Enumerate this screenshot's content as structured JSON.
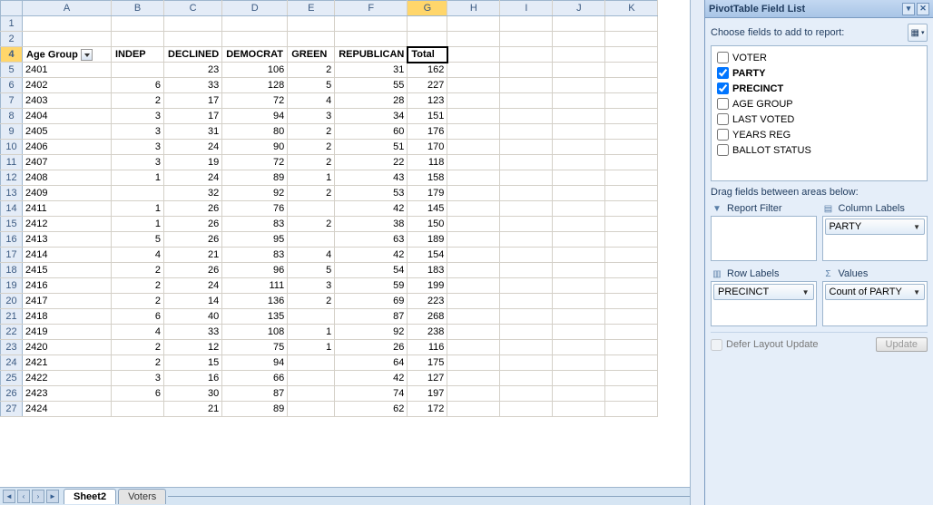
{
  "active_cell": {
    "row_idx": 4,
    "col_idx": 6
  },
  "columns": [
    "A",
    "B",
    "C",
    "D",
    "E",
    "F",
    "G",
    "H",
    "I",
    "J",
    "K"
  ],
  "active_col": "G",
  "header_row_num": 4,
  "headers": [
    "Age Group",
    "INDEP",
    "DECLINED",
    "DEMOCRAT",
    "GREEN",
    "REPUBLICAN",
    "Total"
  ],
  "rows": [
    {
      "n": 5,
      "c": [
        "2401",
        "",
        "23",
        "106",
        "2",
        "31",
        "162"
      ]
    },
    {
      "n": 6,
      "c": [
        "2402",
        "6",
        "33",
        "128",
        "5",
        "55",
        "227"
      ]
    },
    {
      "n": 7,
      "c": [
        "2403",
        "2",
        "17",
        "72",
        "4",
        "28",
        "123"
      ]
    },
    {
      "n": 8,
      "c": [
        "2404",
        "3",
        "17",
        "94",
        "3",
        "34",
        "151"
      ]
    },
    {
      "n": 9,
      "c": [
        "2405",
        "3",
        "31",
        "80",
        "2",
        "60",
        "176"
      ]
    },
    {
      "n": 10,
      "c": [
        "2406",
        "3",
        "24",
        "90",
        "2",
        "51",
        "170"
      ]
    },
    {
      "n": 11,
      "c": [
        "2407",
        "3",
        "19",
        "72",
        "2",
        "22",
        "118"
      ]
    },
    {
      "n": 12,
      "c": [
        "2408",
        "1",
        "24",
        "89",
        "1",
        "43",
        "158"
      ]
    },
    {
      "n": 13,
      "c": [
        "2409",
        "",
        "32",
        "92",
        "2",
        "53",
        "179"
      ]
    },
    {
      "n": 14,
      "c": [
        "2411",
        "1",
        "26",
        "76",
        "",
        "42",
        "145"
      ]
    },
    {
      "n": 15,
      "c": [
        "2412",
        "1",
        "26",
        "83",
        "2",
        "38",
        "150"
      ]
    },
    {
      "n": 16,
      "c": [
        "2413",
        "5",
        "26",
        "95",
        "",
        "63",
        "189"
      ]
    },
    {
      "n": 17,
      "c": [
        "2414",
        "4",
        "21",
        "83",
        "4",
        "42",
        "154"
      ]
    },
    {
      "n": 18,
      "c": [
        "2415",
        "2",
        "26",
        "96",
        "5",
        "54",
        "183"
      ]
    },
    {
      "n": 19,
      "c": [
        "2416",
        "2",
        "24",
        "111",
        "3",
        "59",
        "199"
      ]
    },
    {
      "n": 20,
      "c": [
        "2417",
        "2",
        "14",
        "136",
        "2",
        "69",
        "223"
      ]
    },
    {
      "n": 21,
      "c": [
        "2418",
        "6",
        "40",
        "135",
        "",
        "87",
        "268"
      ]
    },
    {
      "n": 22,
      "c": [
        "2419",
        "4",
        "33",
        "108",
        "1",
        "92",
        "238"
      ]
    },
    {
      "n": 23,
      "c": [
        "2420",
        "2",
        "12",
        "75",
        "1",
        "26",
        "116"
      ]
    },
    {
      "n": 24,
      "c": [
        "2421",
        "2",
        "15",
        "94",
        "",
        "64",
        "175"
      ]
    },
    {
      "n": 25,
      "c": [
        "2422",
        "3",
        "16",
        "66",
        "",
        "42",
        "127"
      ]
    },
    {
      "n": 26,
      "c": [
        "2423",
        "6",
        "30",
        "87",
        "",
        "74",
        "197"
      ]
    },
    {
      "n": 27,
      "c": [
        "2424",
        "",
        "21",
        "89",
        "",
        "62",
        "172"
      ]
    }
  ],
  "blank_lead_rows": [
    1,
    2
  ],
  "tabs": {
    "items": [
      "Sheet2",
      "Voters"
    ],
    "active": "Sheet2"
  },
  "pane": {
    "title": "PivotTable Field List",
    "choose": "Choose fields to add to report:",
    "fields": [
      {
        "label": "VOTER",
        "checked": false
      },
      {
        "label": "PARTY",
        "checked": true
      },
      {
        "label": "PRECINCT",
        "checked": true
      },
      {
        "label": "AGE  GROUP",
        "checked": false
      },
      {
        "label": "LAST  VOTED",
        "checked": false
      },
      {
        "label": "YEARS  REG",
        "checked": false
      },
      {
        "label": "BALLOT  STATUS",
        "checked": false
      }
    ],
    "drag": "Drag fields between areas below:",
    "areas": {
      "filter": {
        "label": "Report Filter",
        "items": []
      },
      "columns": {
        "label": "Column Labels",
        "items": [
          "PARTY"
        ]
      },
      "rows": {
        "label": "Row Labels",
        "items": [
          "PRECINCT"
        ]
      },
      "values": {
        "label": "Values",
        "items": [
          "Count of PARTY"
        ]
      }
    },
    "defer": "Defer Layout Update",
    "update": "Update"
  }
}
